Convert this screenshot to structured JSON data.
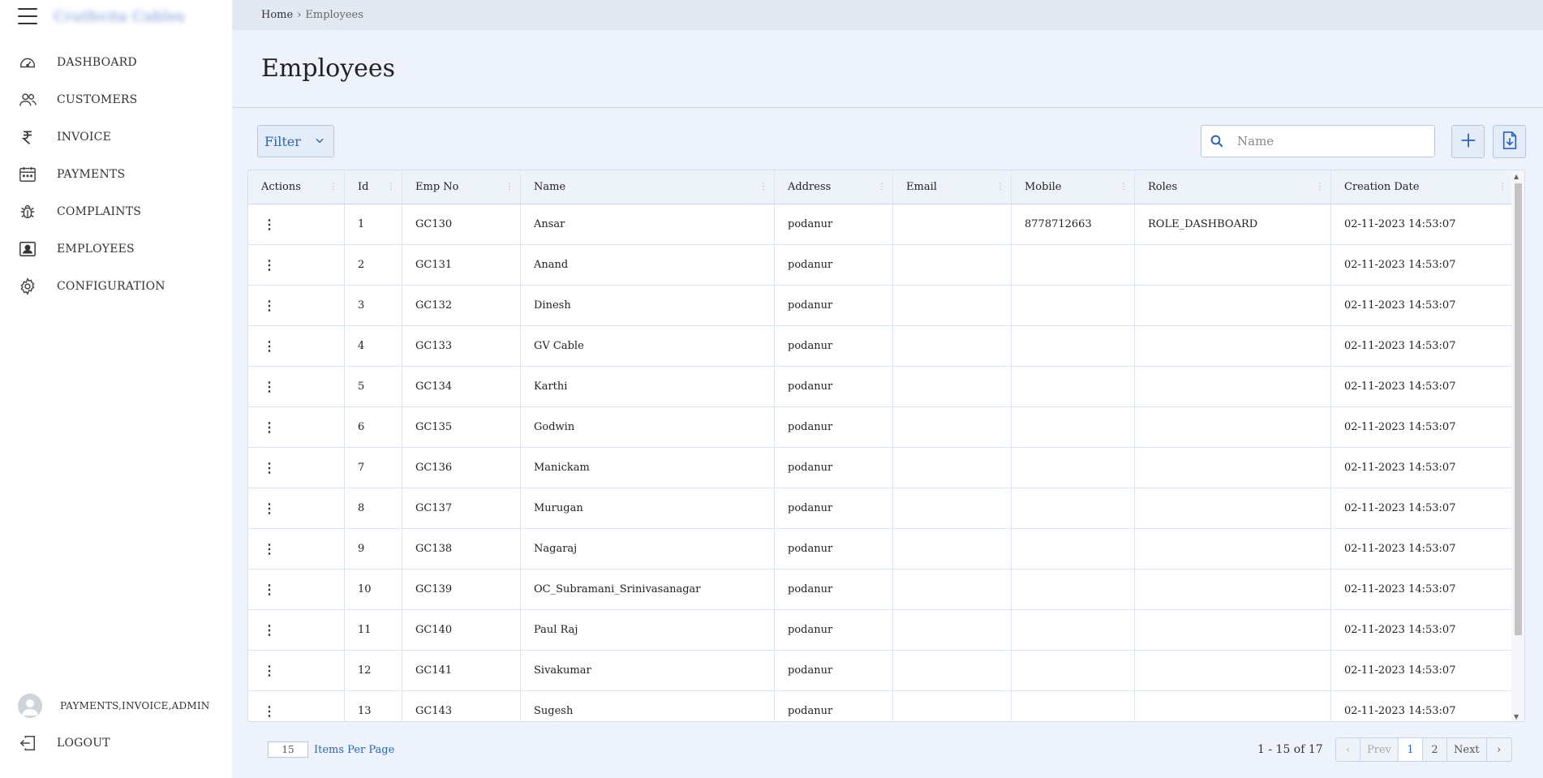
{
  "app": {
    "brand": "Cruthvita Cables"
  },
  "sidebar": {
    "items": [
      {
        "label": "DASHBOARD",
        "icon": "dashboard-icon"
      },
      {
        "label": "CUSTOMERS",
        "icon": "customers-icon"
      },
      {
        "label": "INVOICE",
        "icon": "rupee-icon"
      },
      {
        "label": "PAYMENTS",
        "icon": "calendar-icon"
      },
      {
        "label": "COMPLAINTS",
        "icon": "bug-icon"
      },
      {
        "label": "EMPLOYEES",
        "icon": "employee-badge-icon"
      },
      {
        "label": "CONFIGURATION",
        "icon": "gear-icon"
      }
    ],
    "user_roles": "PAYMENTS,INVOICE,ADMIN",
    "logout_label": "LOGOUT"
  },
  "breadcrumb": {
    "home": "Home",
    "separator": "›",
    "current": "Employees"
  },
  "page": {
    "title": "Employees"
  },
  "toolbar": {
    "filter_label": "Filter",
    "search_placeholder": "Name"
  },
  "table": {
    "columns": [
      "Actions",
      "Id",
      "Emp No",
      "Name",
      "Address",
      "Email",
      "Mobile",
      "Roles",
      "Creation Date"
    ],
    "rows": [
      {
        "id": "1",
        "emp_no": "GC130",
        "name": "Ansar",
        "address": "podanur",
        "email": "",
        "mobile": "8778712663",
        "roles": "ROLE_DASHBOARD",
        "date": "02-11-2023 14:53:07"
      },
      {
        "id": "2",
        "emp_no": "GC131",
        "name": "Anand",
        "address": "podanur",
        "email": "",
        "mobile": "",
        "roles": "",
        "date": "02-11-2023 14:53:07"
      },
      {
        "id": "3",
        "emp_no": "GC132",
        "name": "Dinesh",
        "address": "podanur",
        "email": "",
        "mobile": "",
        "roles": "",
        "date": "02-11-2023 14:53:07"
      },
      {
        "id": "4",
        "emp_no": "GC133",
        "name": "GV Cable",
        "address": "podanur",
        "email": "",
        "mobile": "",
        "roles": "",
        "date": "02-11-2023 14:53:07"
      },
      {
        "id": "5",
        "emp_no": "GC134",
        "name": "Karthi",
        "address": "podanur",
        "email": "",
        "mobile": "",
        "roles": "",
        "date": "02-11-2023 14:53:07"
      },
      {
        "id": "6",
        "emp_no": "GC135",
        "name": "Godwin",
        "address": "podanur",
        "email": "",
        "mobile": "",
        "roles": "",
        "date": "02-11-2023 14:53:07"
      },
      {
        "id": "7",
        "emp_no": "GC136",
        "name": "Manickam",
        "address": "podanur",
        "email": "",
        "mobile": "",
        "roles": "",
        "date": "02-11-2023 14:53:07"
      },
      {
        "id": "8",
        "emp_no": "GC137",
        "name": "Murugan",
        "address": "podanur",
        "email": "",
        "mobile": "",
        "roles": "",
        "date": "02-11-2023 14:53:07"
      },
      {
        "id": "9",
        "emp_no": "GC138",
        "name": "Nagaraj",
        "address": "podanur",
        "email": "",
        "mobile": "",
        "roles": "",
        "date": "02-11-2023 14:53:07"
      },
      {
        "id": "10",
        "emp_no": "GC139",
        "name": "OC_Subramani_Srinivasanagar",
        "address": "podanur",
        "email": "",
        "mobile": "",
        "roles": "",
        "date": "02-11-2023 14:53:07"
      },
      {
        "id": "11",
        "emp_no": "GC140",
        "name": "Paul Raj",
        "address": "podanur",
        "email": "",
        "mobile": "",
        "roles": "",
        "date": "02-11-2023 14:53:07"
      },
      {
        "id": "12",
        "emp_no": "GC141",
        "name": "Sivakumar",
        "address": "podanur",
        "email": "",
        "mobile": "",
        "roles": "",
        "date": "02-11-2023 14:53:07"
      },
      {
        "id": "13",
        "emp_no": "GC143",
        "name": "Sugesh",
        "address": "podanur",
        "email": "",
        "mobile": "",
        "roles": "",
        "date": "02-11-2023 14:53:07"
      }
    ]
  },
  "pagination": {
    "items_per_page": "15",
    "items_per_page_label": "Items Per Page",
    "range": "1 - 15 of 17",
    "prev_arrow": "‹",
    "prev_label": "Prev",
    "pages": [
      "1",
      "2"
    ],
    "active_page": "1",
    "next_label": "Next",
    "next_arrow": "›"
  },
  "colors": {
    "accent": "#2a64b6",
    "background": "#eef3fb",
    "sidebar": "#ffffff",
    "topbar": "#e2e9f3"
  }
}
